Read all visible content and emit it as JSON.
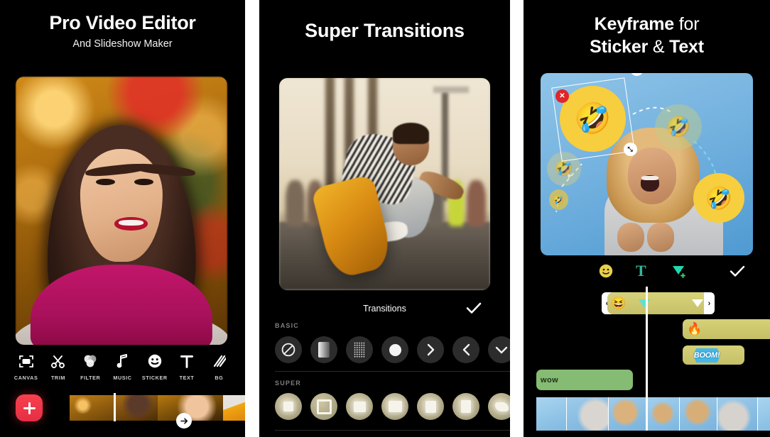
{
  "panel1": {
    "title": "Pro Video Editor",
    "subtitle": "And Slideshow Maker",
    "toolbar": [
      {
        "label": "CANVAS",
        "icon": "canvas-icon"
      },
      {
        "label": "TRIM",
        "icon": "scissors-icon"
      },
      {
        "label": "FILTER",
        "icon": "filter-icon"
      },
      {
        "label": "MUSIC",
        "icon": "music-note-icon"
      },
      {
        "label": "STICKER",
        "icon": "smiley-icon"
      },
      {
        "label": "TEXT",
        "icon": "text-t-icon"
      },
      {
        "label": "BG",
        "icon": "diagonal-lines-icon"
      }
    ],
    "add_button_icon": "plus-icon",
    "transition_button_icon": "arrow-right-icon"
  },
  "panel2": {
    "title": "Super Transitions",
    "sheet_title": "Transitions",
    "confirm_icon": "check-icon",
    "sections": [
      {
        "label": "BASIC",
        "items": [
          {
            "name": "none",
            "icon": "no-entry-icon"
          },
          {
            "name": "fade",
            "icon": "fade-gradient-icon"
          },
          {
            "name": "dissolve",
            "icon": "dither-dots-icon"
          },
          {
            "name": "circle",
            "icon": "circle-icon"
          },
          {
            "name": "slide-right",
            "icon": "chevron-right-icon"
          },
          {
            "name": "slide-left",
            "icon": "chevron-left-icon"
          },
          {
            "name": "slide-down",
            "icon": "chevron-down-icon"
          }
        ]
      },
      {
        "label": "SUPER",
        "items": [
          {
            "name": "super-1",
            "icon": "square-glow-icon"
          },
          {
            "name": "super-2",
            "icon": "square-ring-icon"
          },
          {
            "name": "super-3",
            "icon": "square-wide-icon"
          },
          {
            "name": "super-4",
            "icon": "square-soft-icon"
          },
          {
            "name": "super-5",
            "icon": "square-tall-icon"
          },
          {
            "name": "super-6",
            "icon": "square-narrow-icon"
          },
          {
            "name": "super-7",
            "icon": "blob-icon"
          }
        ]
      }
    ]
  },
  "panel3": {
    "title_line1_bold": "Keyframe",
    "title_line1_light": "for",
    "title_line2_bold_a": "Sticker",
    "title_line2_light": "&",
    "title_line2_bold_b": "Text",
    "canvas": {
      "sticker_emoji": "🤣",
      "ghost_emoji": "🤣",
      "delete_handle": "✕",
      "info_handle": "i",
      "rotate_handle": "⤡"
    },
    "toolbar": [
      {
        "name": "sticker",
        "icon": "smiley-icon",
        "glyph": "🙂"
      },
      {
        "name": "text",
        "icon": "text-t-icon",
        "glyph": "T"
      },
      {
        "name": "keyframe",
        "icon": "keyframe-add-icon",
        "glyph": "▼"
      },
      {
        "name": "confirm",
        "icon": "check-icon",
        "glyph": "✓"
      }
    ],
    "timeline": {
      "selected_clip": {
        "thumb_emoji": "😆",
        "left_handle": "‹",
        "right_handle": "›",
        "keyframe_marker": "keyframe-diamond-icon",
        "end_marker": "keyframe-triangle-icon"
      },
      "clips": [
        {
          "name": "fire-sticker-clip",
          "emoji": "🔥",
          "color": "#d6d079"
        },
        {
          "name": "boom-sticker-clip",
          "label": "BOOM!",
          "color": "#d6d079"
        },
        {
          "name": "wow-text-clip",
          "label": "wow",
          "color": "#85bb72"
        }
      ]
    }
  }
}
